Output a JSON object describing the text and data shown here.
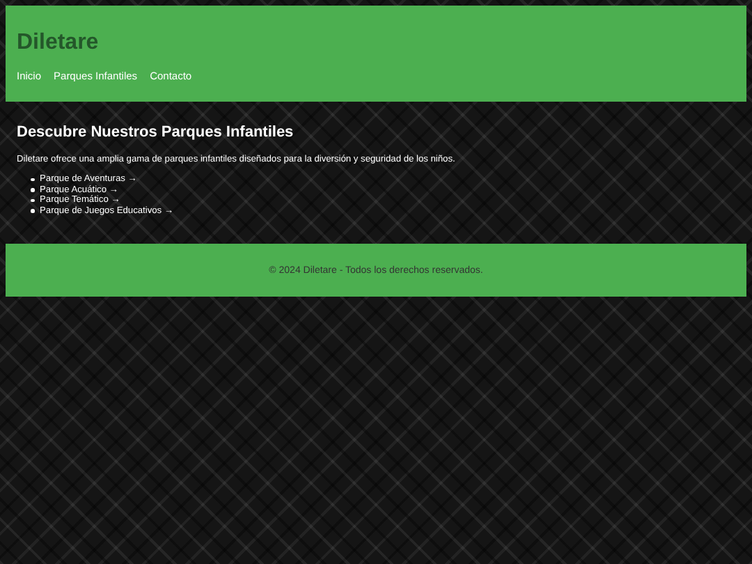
{
  "header": {
    "title": "Diletare",
    "nav": [
      "Inicio",
      "Parques Infantiles",
      "Contacto"
    ]
  },
  "main": {
    "heading": "Descubre Nuestros Parques Infantiles",
    "intro": "Diletare ofrece una amplia gama de parques infantiles diseñados para la diversión y seguridad de los niños.",
    "parks": [
      "Parque de Aventuras →",
      "Parque Acuático →",
      "Parque Temático →",
      "Parque de Juegos Educativos →"
    ]
  },
  "footer": {
    "text": "© 2024 Diletare - Todos los derechos reservados."
  }
}
